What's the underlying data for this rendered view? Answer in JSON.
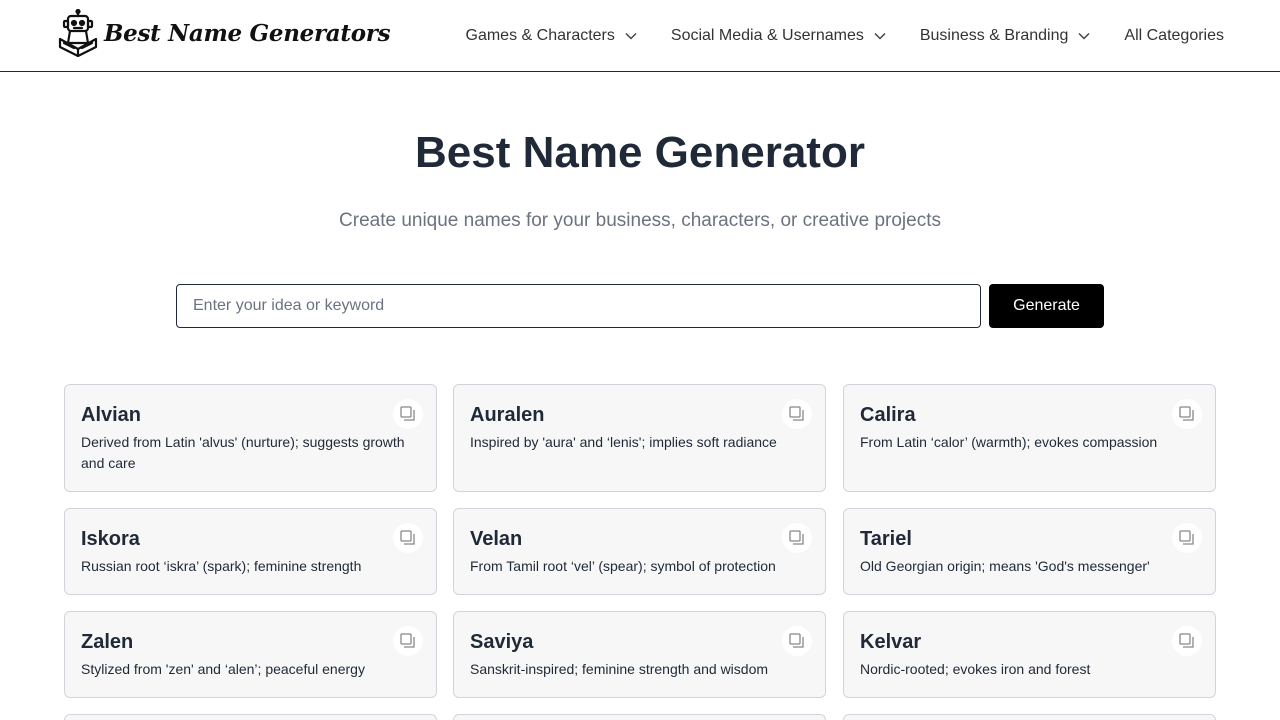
{
  "header": {
    "logo_text": "Best Name Generators",
    "nav": [
      {
        "label": "Games & Characters",
        "has_dropdown": true
      },
      {
        "label": "Social Media & Usernames",
        "has_dropdown": true
      },
      {
        "label": "Business & Branding",
        "has_dropdown": true
      },
      {
        "label": "All Categories",
        "has_dropdown": false
      }
    ]
  },
  "hero": {
    "title": "Best Name Generator",
    "subtitle": "Create unique names for your business, characters, or creative projects"
  },
  "search": {
    "placeholder": "Enter your idea or keyword",
    "value": "",
    "button_label": "Generate"
  },
  "results": [
    {
      "name": "Alvian",
      "desc": "Derived from Latin 'alvus' (nurture); suggests growth and care"
    },
    {
      "name": "Auralen",
      "desc": "Inspired by 'aura' and ‘lenis'; implies soft radiance"
    },
    {
      "name": "Calira",
      "desc": "From Latin ‘calor’ (warmth); evokes compassion"
    },
    {
      "name": "Iskora",
      "desc": "Russian root ‘iskra’ (spark); feminine strength"
    },
    {
      "name": "Velan",
      "desc": "From Tamil root ‘vel’ (spear); symbol of protection"
    },
    {
      "name": "Tariel",
      "desc": "Old Georgian origin; means 'God's messenger'"
    },
    {
      "name": "Zalen",
      "desc": "Stylized from 'zen' and ‘alen’; peaceful energy"
    },
    {
      "name": "Saviya",
      "desc": "Sanskrit-inspired; feminine strength and wisdom"
    },
    {
      "name": "Kelvar",
      "desc": "Nordic-rooted; evokes iron and forest"
    }
  ],
  "icons": {
    "logo": "robot-reading-icon",
    "dropdown": "chevron-down-icon",
    "copy": "copy-icon"
  },
  "colors": {
    "accent": "#000000",
    "card_bg": "#f7f7f7",
    "text": "#1f2937",
    "muted": "#6b7280"
  }
}
